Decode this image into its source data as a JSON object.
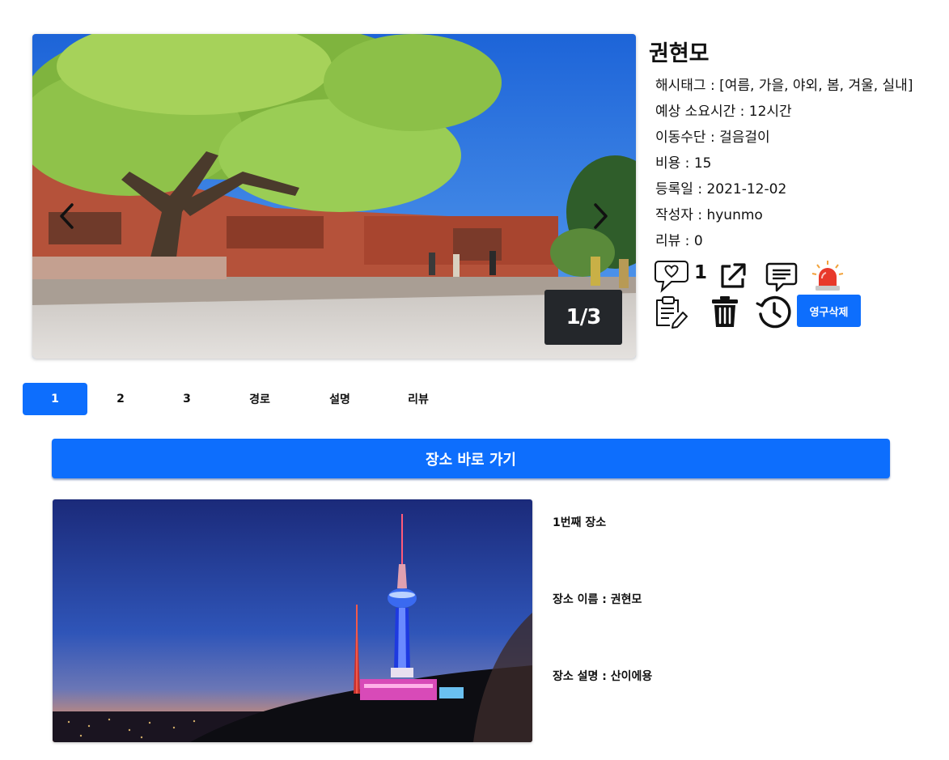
{
  "carousel": {
    "counter": "1/3",
    "current": 1,
    "total": 3
  },
  "post": {
    "title": "권현모",
    "info": [
      {
        "key": "해시태그 : ",
        "value": "[여름, 가을, 야외, 봄, 겨울, 실내]"
      },
      {
        "key": "예상 소요시간 : ",
        "value": "12시간"
      },
      {
        "key": "이동수단 : ",
        "value": "걸음걸이"
      },
      {
        "key": "비용 : ",
        "value": "15"
      },
      {
        "key": "등록일 : ",
        "value": "2021-12-02"
      },
      {
        "key": "작성자 : ",
        "value": "hyunmo"
      },
      {
        "key": "리뷰 : ",
        "value": "0"
      }
    ],
    "like_count": "1",
    "permanent_delete_label": "영구삭제"
  },
  "icons": [
    "heart-speech-icon",
    "external-link-icon",
    "comment-icon",
    "siren-icon",
    "edit-clipboard-icon",
    "trash-icon",
    "history-icon",
    "chevron-left-icon",
    "chevron-right-icon"
  ],
  "tabs": [
    {
      "label": "1",
      "active": true
    },
    {
      "label": "2",
      "active": false
    },
    {
      "label": "3",
      "active": false
    },
    {
      "label": "경로",
      "active": false
    },
    {
      "label": "설명",
      "active": false
    },
    {
      "label": "리뷰",
      "active": false
    }
  ],
  "go_button_label": "장소 바로 가기",
  "place": {
    "order": "1번째 장소",
    "name_label": "장소 이름 : ",
    "name": "권현모",
    "desc_label": "장소 설명 : ",
    "desc": "산이에용"
  },
  "colors": {
    "primary": "#0d6efd",
    "counter_bg": "#24272b",
    "siren_red": "#e8392b"
  }
}
